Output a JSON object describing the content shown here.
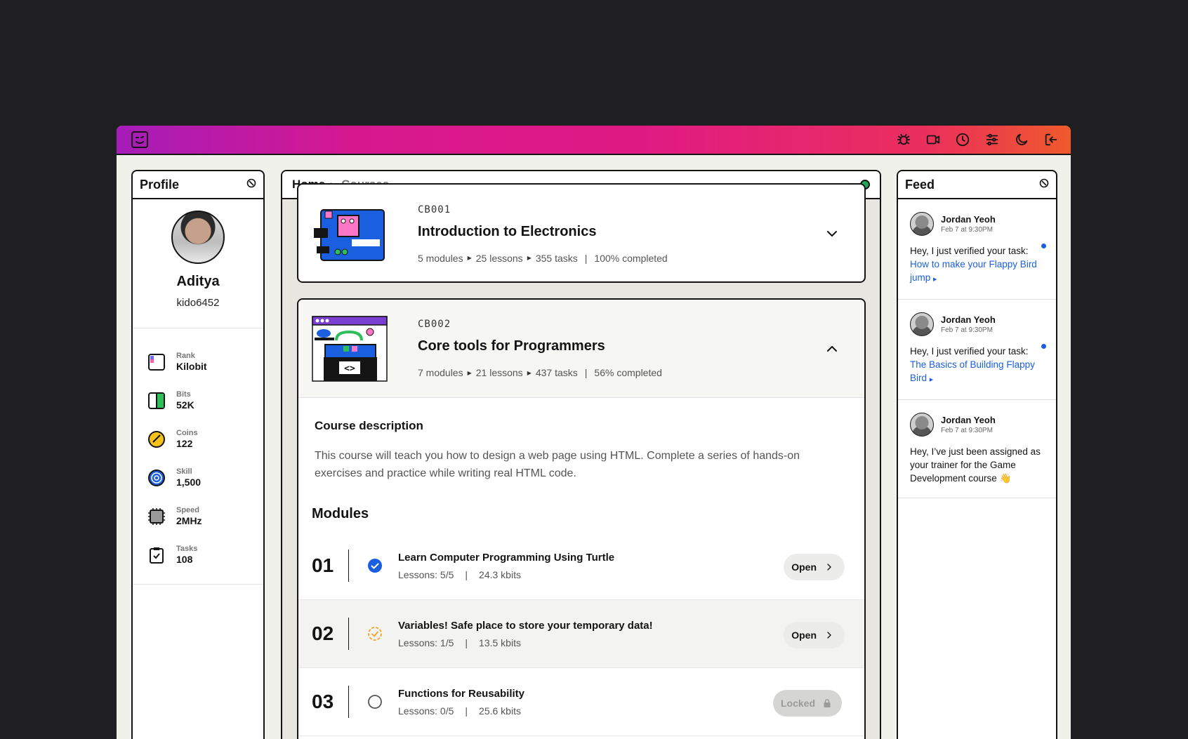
{
  "profile": {
    "title": "Profile",
    "name": "Aditya",
    "handle": "kido6452",
    "stats": [
      {
        "label": "Rank",
        "value": "Kilobit",
        "icon": "rank-icon"
      },
      {
        "label": "Bits",
        "value": "52K",
        "icon": "bits-icon"
      },
      {
        "label": "Coins",
        "value": "122",
        "icon": "coins-icon"
      },
      {
        "label": "Skill",
        "value": "1,500",
        "icon": "skill-icon"
      },
      {
        "label": "Speed",
        "value": "2MHz",
        "icon": "speed-icon"
      },
      {
        "label": "Tasks",
        "value": "108",
        "icon": "tasks-icon"
      }
    ]
  },
  "breadcrumb": {
    "home": "Home",
    "current": "Courses"
  },
  "courses": [
    {
      "code": "CB001",
      "title": "Introduction to Electronics",
      "modules": "5 modules",
      "lessons": "25 lessons",
      "tasks": "355 tasks",
      "completed": "100% completed",
      "expanded": false
    },
    {
      "code": "CB002",
      "title": "Core tools for Programmers",
      "modules": "7 modules",
      "lessons": "21 lessons",
      "tasks": "437 tasks",
      "completed": "56% completed",
      "expanded": true,
      "description_title": "Course description",
      "description": "This course will teach you how to design a web page using HTML. Complete a series of hands-on exercises and practice while writing real HTML code.",
      "modules_title": "Modules",
      "module_list": [
        {
          "num": "01",
          "title": "Learn Computer Programming Using Turtle",
          "lessons": "Lessons: 5/5",
          "size": "24.3 kbits",
          "action": "Open",
          "status": "complete"
        },
        {
          "num": "02",
          "title": "Variables! Safe place to store your temporary data!",
          "lessons": "Lessons: 1/5",
          "size": "13.5 kbits",
          "action": "Open",
          "status": "in-progress"
        },
        {
          "num": "03",
          "title": "Functions for Reusability",
          "lessons": "Lessons: 0/5",
          "size": "25.6 kbits",
          "action": "Locked",
          "status": "locked"
        }
      ]
    }
  ],
  "feed": {
    "title": "Feed",
    "items": [
      {
        "name": "Jordan Yeoh",
        "time": "Feb 7 at 9:30PM",
        "text": "Hey, I just verified your task: ",
        "link": "How to make your Flappy Bird jump",
        "unread": true
      },
      {
        "name": "Jordan Yeoh",
        "time": "Feb 7 at 9:30PM",
        "text": "Hey, I just verified your task: ",
        "link": "The Basics of Building Flappy Bird",
        "unread": true
      },
      {
        "name": "Jordan Yeoh",
        "time": "Feb 7 at 9:30PM",
        "text": "Hey, I’ve just been assigned as your trainer for the Game Development course 👋",
        "link": "",
        "unread": false
      }
    ]
  },
  "colors": {
    "accent": "#1a5fe0",
    "online": "#1faa57",
    "progress": "#f5a524"
  }
}
